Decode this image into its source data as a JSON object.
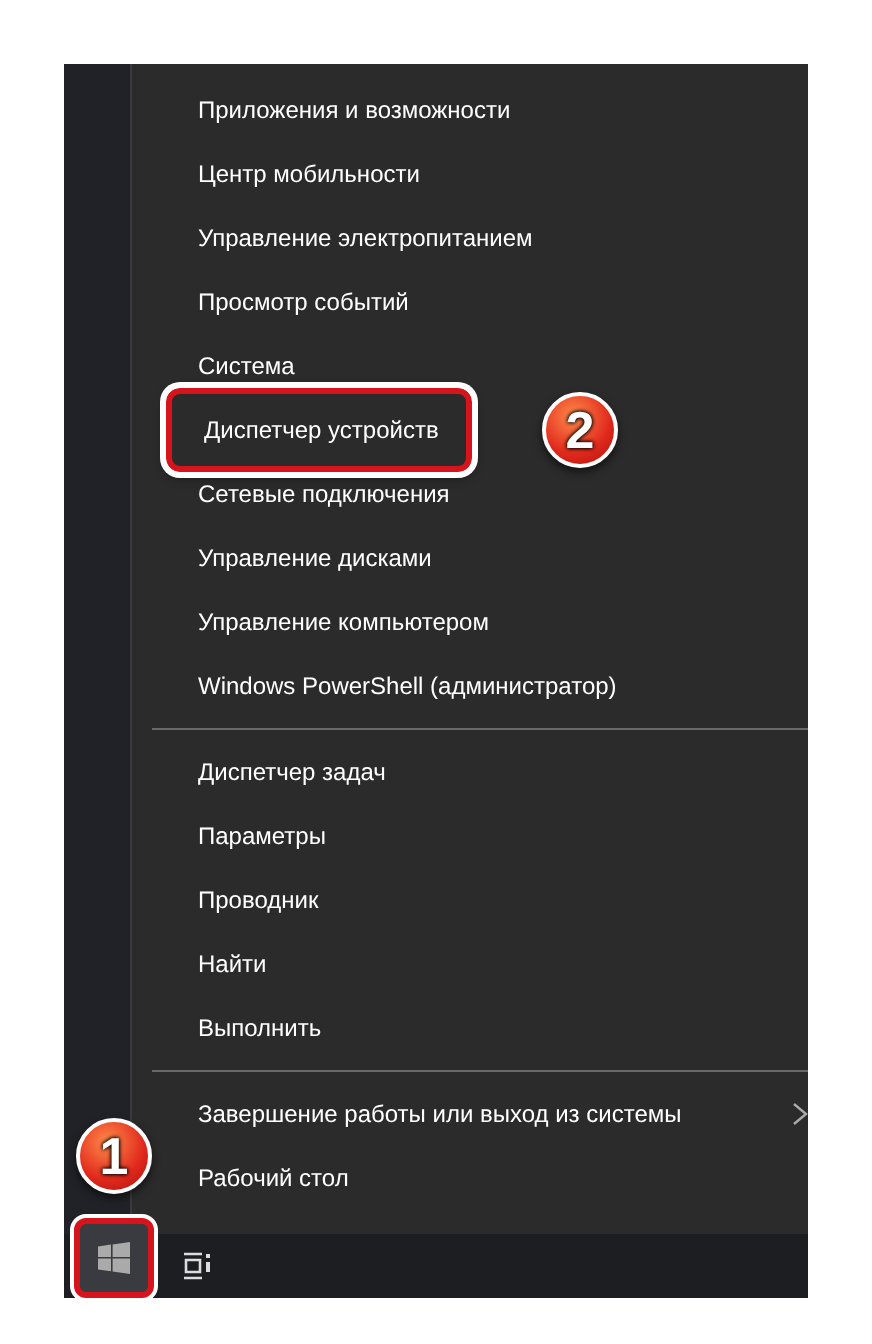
{
  "menu": {
    "groups": [
      {
        "items": [
          {
            "label": "Приложения и возможности",
            "highlighted": false
          },
          {
            "label": "Центр мобильности",
            "highlighted": false
          },
          {
            "label": "Управление электропитанием",
            "highlighted": false
          },
          {
            "label": "Просмотр событий",
            "highlighted": false
          },
          {
            "label": "Система",
            "highlighted": false
          },
          {
            "label": "Диспетчер устройств",
            "highlighted": true,
            "callout": "2"
          },
          {
            "label": "Сетевые подключения",
            "highlighted": false
          },
          {
            "label": "Управление дисками",
            "highlighted": false
          },
          {
            "label": "Управление компьютером",
            "highlighted": false
          },
          {
            "label": "Windows PowerShell (администратор)",
            "highlighted": false
          }
        ]
      },
      {
        "items": [
          {
            "label": "Диспетчер задач",
            "highlighted": false
          },
          {
            "label": "Параметры",
            "highlighted": false
          },
          {
            "label": "Проводник",
            "highlighted": false
          },
          {
            "label": "Найти",
            "highlighted": false
          },
          {
            "label": "Выполнить",
            "highlighted": false
          }
        ]
      },
      {
        "items": [
          {
            "label": "Завершение работы или выход из системы",
            "highlighted": false,
            "submenu": true
          },
          {
            "label": "Рабочий стол",
            "highlighted": false
          }
        ]
      }
    ]
  },
  "taskbar": {
    "start_button": {
      "highlighted": true,
      "callout": "1"
    }
  }
}
